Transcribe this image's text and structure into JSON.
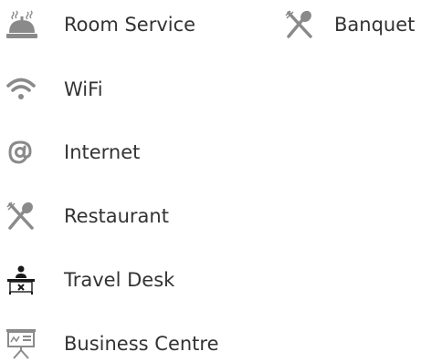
{
  "amenities": {
    "room_service": {
      "label": "Room Service",
      "icon": "room-service-bell-icon"
    },
    "banquet": {
      "label": "Banquet",
      "icon": "fork-spoon-icon"
    },
    "wifi": {
      "label": "WiFi",
      "icon": "wifi-icon"
    },
    "internet": {
      "label": "Internet",
      "icon": "at-sign-icon"
    },
    "restaurant": {
      "label": "Restaurant",
      "icon": "fork-spoon-icon"
    },
    "travel_desk": {
      "label": "Travel Desk",
      "icon": "travel-desk-icon"
    },
    "business_centre": {
      "label": "Business Centre",
      "icon": "presentation-board-icon"
    }
  },
  "colors": {
    "icon_gray": "#8a8a8a",
    "icon_dark": "#1a1a1a",
    "text": "#333333",
    "background": "#ffffff"
  }
}
